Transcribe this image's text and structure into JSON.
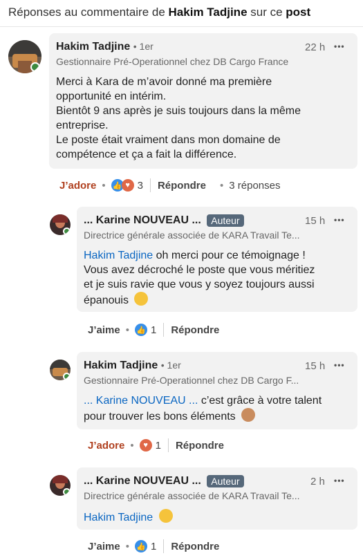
{
  "header": {
    "prefix": "Réponses au commentaire de ",
    "author": "Hakim Tadjine",
    "middle": " sur ce ",
    "post": "post"
  },
  "comments": [
    {
      "name": "Hakim Tadjine",
      "degree": "• 1er",
      "subtitle": "Gestionnaire Pré-Operationnel chez DB Cargo France",
      "time": "22 h",
      "more": "•••",
      "lines": [
        "Merci à Kara de m’avoir donné ma première",
        "opportunité en intérim.",
        "Bientôt 9 ans après je suis toujours dans la même",
        "entreprise.",
        "Le poste était vraiment dans mon domaine de",
        "compétence et ça a fait la différence."
      ],
      "action_react": "J’adore",
      "reaction_count": "3",
      "reply": "Répondre",
      "replies": "3 réponses"
    },
    {
      "name": "... Karine NOUVEAU ...",
      "badge": "Auteur",
      "subtitle": "Directrice générale associée de KARA Travail Te...",
      "time": "15 h",
      "more": "•••",
      "mention": "Hakim Tadjine",
      "line1_rest": " oh merci pour ce témoignage !",
      "lines": [
        "Vous avez décroché le poste que vous méritiez",
        "et je suis ravie que vous y soyez toujours aussi",
        "épanouis"
      ],
      "emoji": "star-struck-emoji",
      "action_react": "J’aime",
      "reaction_count": "1",
      "reply": "Répondre"
    },
    {
      "name": "Hakim Tadjine",
      "degree": "• 1er",
      "subtitle": "Gestionnaire Pré-Operationnel chez DB Cargo F...",
      "time": "15 h",
      "more": "•••",
      "mention": "... Karine NOUVEAU ...",
      "line1_rest": " c’est grâce à votre talent",
      "lines": [
        "pour trouver les bons éléments"
      ],
      "emoji": "ok-hand-emoji",
      "action_react": "J’adore",
      "reaction_count": "1",
      "reply": "Répondre"
    },
    {
      "name": "... Karine NOUVEAU ...",
      "badge": "Auteur",
      "subtitle": "Directrice générale associée de KARA Travail Te...",
      "time": "2 h",
      "more": "•••",
      "mention": "Hakim Tadjine",
      "emoji": "smiling-emoji",
      "action_react": "J’aime",
      "reaction_count": "1",
      "reply": "Répondre"
    }
  ],
  "colors": {
    "mention": "#0a66c2",
    "adore": "#b0401f",
    "like": "#378fe9",
    "love": "#e06847",
    "bubble": "#f2f2f2",
    "badge": "#56687a"
  }
}
